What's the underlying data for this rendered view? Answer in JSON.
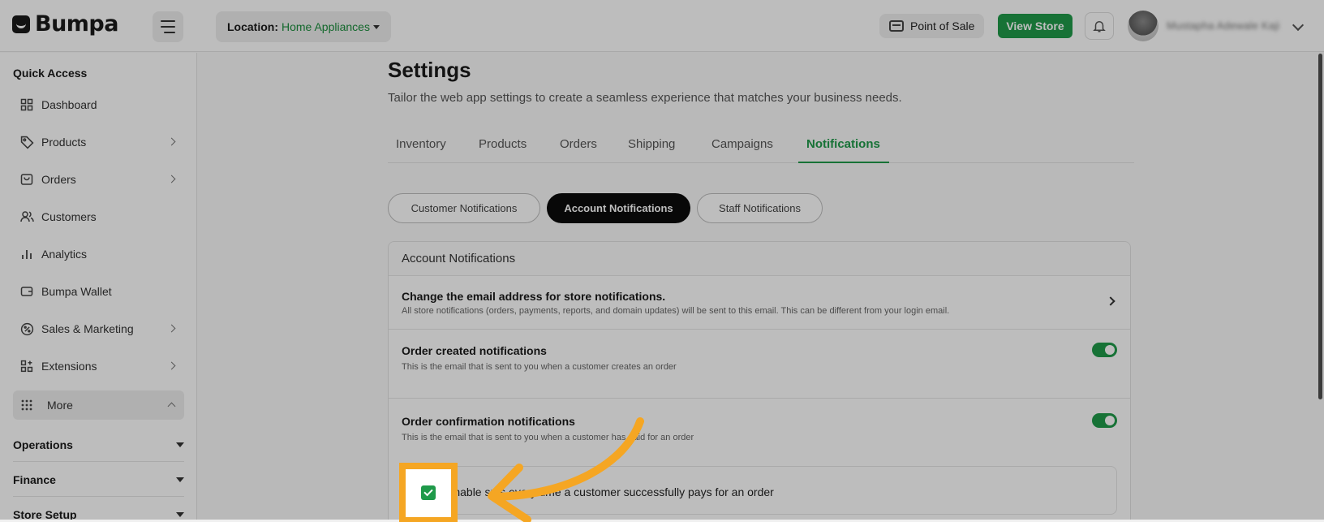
{
  "header": {
    "brand": "Bumpa",
    "location_label": "Location:",
    "location_value": "Home Appliances",
    "point_of_sale": "Point of Sale",
    "view_store": "View Store",
    "user_name": "Mustapha Adewale Kaji"
  },
  "sidebar": {
    "quick_access": "Quick Access",
    "items": [
      {
        "label": "Dashboard",
        "icon": "grid-icon"
      },
      {
        "label": "Products",
        "icon": "tag-icon"
      },
      {
        "label": "Orders",
        "icon": "bag-icon"
      },
      {
        "label": "Customers",
        "icon": "users-icon"
      },
      {
        "label": "Analytics",
        "icon": "bar-chart-icon"
      },
      {
        "label": "Bumpa Wallet",
        "icon": "wallet-icon"
      },
      {
        "label": "Sales & Marketing",
        "icon": "percent-icon"
      },
      {
        "label": "Extensions",
        "icon": "puzzle-icon"
      },
      {
        "label": "More",
        "icon": "dots-grid-icon"
      }
    ],
    "groups": [
      "Operations",
      "Finance",
      "Store Setup"
    ]
  },
  "page": {
    "title": "Settings",
    "subtitle": "Tailor the web app settings to create a seamless experience that matches your business needs.",
    "tabs": [
      "Inventory",
      "Products",
      "Orders",
      "Shipping",
      "Campaigns",
      "Notifications"
    ],
    "active_tab": "Notifications",
    "pills": [
      "Customer Notifications",
      "Account Notifications",
      "Staff Notifications"
    ],
    "active_pill": "Account Notifications"
  },
  "card": {
    "title": "Account Notifications",
    "rows": [
      {
        "title": "Change the email address for store notifications.",
        "desc": "All store notifications (orders, payments, reports, and domain updates) will be sent to this email. This can be different from your login email."
      },
      {
        "title": "Order created notifications",
        "desc": "This is the email that is sent to you when a customer creates an order"
      },
      {
        "title": "Order confirmation notifications",
        "desc": "This is the email that is sent to you when a customer has paid for an order"
      }
    ],
    "sms_option": "Enable sms every time a customer successfully pays for an order"
  },
  "colors": {
    "brand_green": "#1f9a4a",
    "highlight": "#f5a623"
  }
}
